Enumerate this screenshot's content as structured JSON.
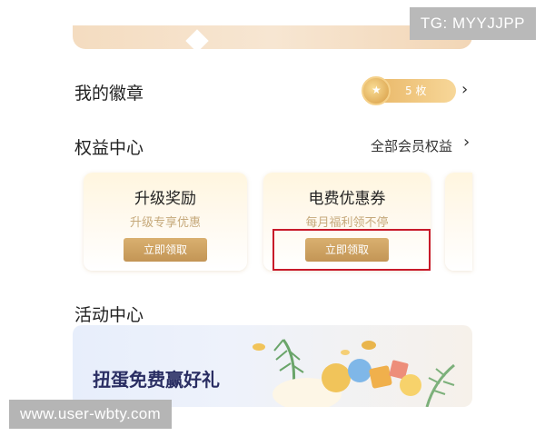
{
  "watermarks": {
    "tg": "TG: MYYJJPP",
    "url": "www.user-wbty.com"
  },
  "badges": {
    "title": "我的徽章",
    "count": "5 枚"
  },
  "rights": {
    "title": "权益中心",
    "all_link": "全部会员权益",
    "cards": [
      {
        "title": "升级奖励",
        "subtitle": "升级专享优惠",
        "button": "立即领取"
      },
      {
        "title": "电费优惠券",
        "subtitle": "每月福利领不停",
        "button": "立即领取"
      }
    ]
  },
  "activity": {
    "title": "活动中心",
    "banner_text": "扭蛋免费赢好礼"
  },
  "colors": {
    "accent_gold": "#c39556",
    "highlight_red": "#c81a2a",
    "banner_text": "#2a2e63"
  }
}
